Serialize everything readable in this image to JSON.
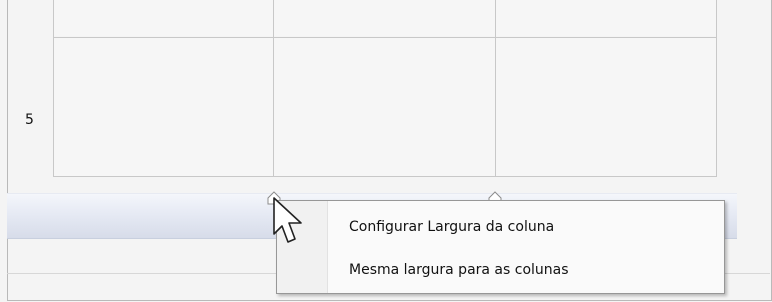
{
  "grid": {
    "row_label": "5"
  },
  "context_menu": {
    "items": [
      {
        "label": "Configurar Largura da coluna"
      },
      {
        "label": "Mesma largura para as colunas"
      }
    ]
  },
  "icons": {
    "left_column_handle": "column-resize-handle-icon",
    "right_column_handle": "column-resize-handle-icon",
    "pointer": "mouse-pointer-icon"
  },
  "colors": {
    "ruler_top": "#f4f6fb",
    "ruler_bottom": "#d7dce9",
    "grid_lines": "#c8c8c8",
    "menu_border": "#979797"
  }
}
